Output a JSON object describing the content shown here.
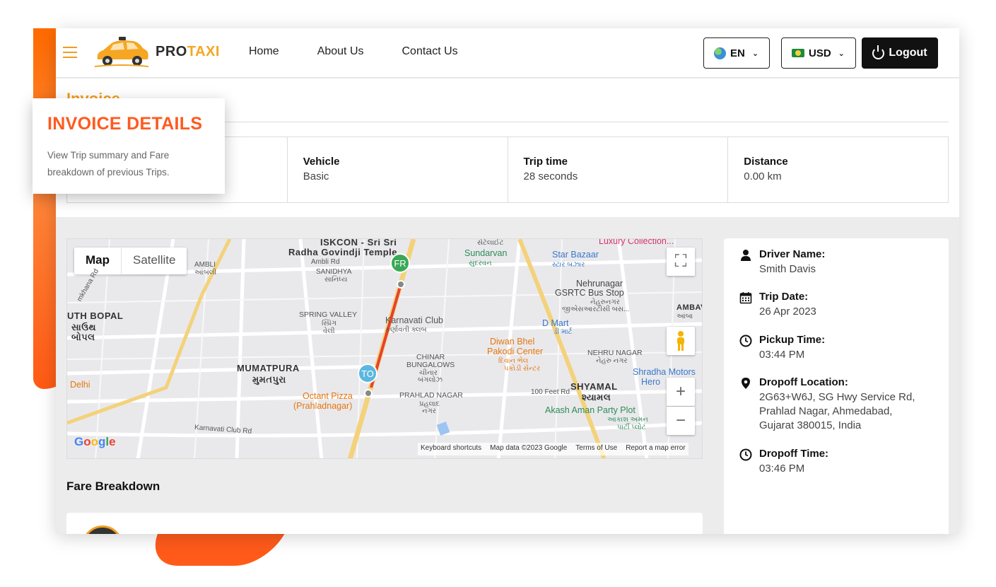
{
  "brand": {
    "pro": "PRO",
    "taxi": "TAXI"
  },
  "nav": {
    "items": [
      "Home",
      "About Us",
      "Contact Us"
    ]
  },
  "header": {
    "language": "EN",
    "currency": "USD",
    "logout_label": "Logout"
  },
  "page": {
    "title": "Invoice"
  },
  "summary": [
    {
      "label": "",
      "value": ""
    },
    {
      "label": "Vehicle",
      "value": "Basic"
    },
    {
      "label": "Trip time",
      "value": "28 seconds"
    },
    {
      "label": "Distance",
      "value": "0.00 km"
    }
  ],
  "map": {
    "toggle_map": "Map",
    "toggle_satellite": "Satellite",
    "marker_from": "FR",
    "marker_to": "TO",
    "labels": {
      "iskcon": "ISKCON - Sri Sri",
      "radha": "Radha Govindji Temple",
      "ambli_rd": "Ambli Rd",
      "ambli": "AMBLI",
      "ambli_gu": "આંબલી",
      "sanidhya": "SANIDHYA",
      "sanidhya_gu": "સાનિધ્ય",
      "sundarvan": "Sundarvan",
      "sundarvan_gu": "સુંદરવન",
      "star_bazaar": "Star Bazaar",
      "star_bazaar_gu": "સ્ટાર બઝાર",
      "luxury": "Luxury Collection...",
      "satellite_gu": "સેટેલાઈટ",
      "nehrunagar": "Nehrunagar",
      "gsrtc": "GSRTC Bus Stop",
      "nehrunagar_gu": "નેહરુનગર",
      "gsrtc_gu": "જીએસઆરટીસી બસ...",
      "ambawadi": "AMBAV",
      "ambawadi_gu": "આંબા",
      "south_bopal": "UTH BOPAL",
      "south_bopal_gu1": "સાઉથ",
      "south_bopal_gu2": "બોપલ",
      "spring_valley": "SPRING VALLEY",
      "spring_valley_gu1": "સ્પ્રિંગ",
      "spring_valley_gu2": "વેલી",
      "karnavati_club": "Karnavati Club",
      "karnavati_club_gu": "કર્ણાવતી ક્લબ",
      "dmart": "D Mart",
      "dmart_gu": "ડી માર્ટ",
      "diwan": "Diwan Bhel",
      "pakodi": "Pakodi Center",
      "diwan_gu1": "દિવાન ભેલ",
      "diwan_gu2": "પકોડી સેન્ટર",
      "chinar": "CHINAR",
      "bungalows": "BUNGALOWS",
      "chinar_gu1": "ચીનાર",
      "chinar_gu2": "બંગલોઝ",
      "nehru_nagar": "NEHRU NAGAR",
      "nehru_nagar_gu": "નેહરુ નગર",
      "mumatpura": "MUMATPURA",
      "mumatpura_gu": "મુમતપુરા",
      "shradha": "Shradha Motors",
      "hero": "Hero",
      "delhi": "Delhi",
      "octant": "Octant Pizza",
      "prahladnagar_p": "(Prahladnagar)",
      "prahlad": "PRAHLAD NAGAR",
      "prahlad_gu1": "પ્રહલાદ",
      "prahlad_gu2": "નગર",
      "feet_rd": "100 Feet Rd",
      "shyamal": "SHYAMAL",
      "shyamal_gu": "શ્યામલ",
      "akash": "Akash Aman Party Plot",
      "akash_gu1": "આકાશ અમન",
      "akash_gu2": "પાર્ટી પ્લોટ",
      "karnavati_rd": "Karnavati Club Rd",
      "khana_rd": "mkhana Rd"
    },
    "attribution": {
      "shortcuts": "Keyboard shortcuts",
      "data": "Map data ©2023 Google",
      "terms": "Terms of Use",
      "report": "Report a map error"
    },
    "google": [
      "G",
      "o",
      "o",
      "g",
      "l",
      "e"
    ]
  },
  "fare": {
    "title": "Fare Breakdown"
  },
  "details": {
    "driver_label": "Driver Name:",
    "driver_value": "Smith Davis",
    "trip_date_label": "Trip Date:",
    "trip_date_value": "26 Apr 2023",
    "pickup_label": "Pickup Time:",
    "pickup_value": "03:44 PM",
    "dropoff_loc_label": "Dropoff Location:",
    "dropoff_loc_value": "2G63+W6J, SG Hwy Service Rd, Prahlad Nagar, Ahmedabad, Gujarat 380015, India",
    "dropoff_time_label": "Dropoff Time:",
    "dropoff_time_value": "03:46 PM"
  },
  "tooltip": {
    "title": "INVOICE DETAILS",
    "text": "View Trip summary and Fare breakdown of previous Trips."
  },
  "colors": {
    "accent": "#f39c1f",
    "tooltip_title": "#ff5a1f",
    "route": "#e8412c"
  }
}
